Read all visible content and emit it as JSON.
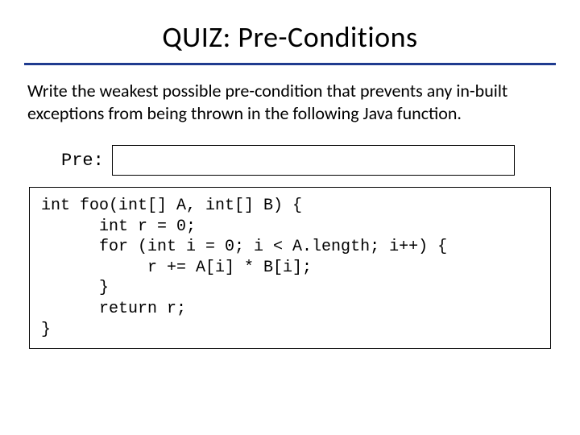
{
  "title": "QUIZ: Pre-Conditions",
  "prompt": "Write the weakest possible pre-condition that prevents any in-built exceptions from being thrown in the following Java function.",
  "pre_label": "Pre:",
  "pre_value": "",
  "code": "int foo(int[] A, int[] B) {\n      int r = 0;\n      for (int i = 0; i < A.length; i++) {\n           r += A[i] * B[i];\n      }\n      return r;\n}"
}
